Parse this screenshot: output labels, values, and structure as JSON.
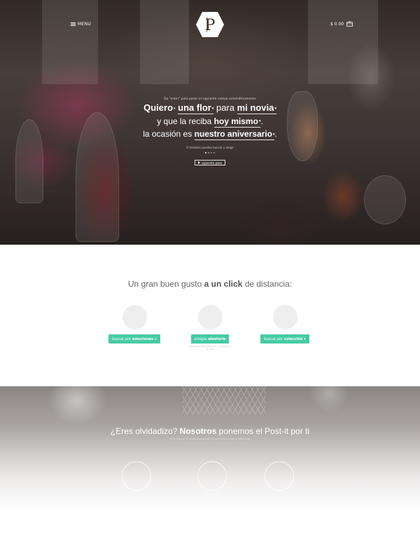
{
  "header": {
    "menu_label": "MENU",
    "logo_letter": "P",
    "cart_total": "$ 0.00"
  },
  "hero": {
    "hint": "Da \"enter\" para pasar al siguiente campo automáticamente",
    "line1": {
      "w1": "Quiero",
      "w2": "una flor",
      "w3": "para",
      "w4": "mi novia"
    },
    "line2": {
      "w1": "y que la reciba",
      "w2": "hoy mismo",
      "w3": "."
    },
    "line3": {
      "w1": "la ocasión es",
      "w2": "nuestro aniversario",
      "w3": "."
    },
    "sub": "O también puedes buscar y elegir",
    "next_button": "siguiente paso",
    "active_dot": 0,
    "dot_count": 4
  },
  "section2": {
    "title_pre": "Un gran buen gusto",
    "title_bold": "a un click",
    "title_post": "de distancia:",
    "options": [
      {
        "pre": "buscar por",
        "bold": "emociones",
        "caret": true,
        "note": ""
      },
      {
        "pre": "arreglo",
        "bold": "aleatorio",
        "caret": false,
        "note": "Déjanos sorprenderte con un arreglo de la casa"
      },
      {
        "pre": "buscar por",
        "bold": "colección",
        "caret": true,
        "note": ""
      }
    ]
  },
  "section3": {
    "title_pre": "¿Eres olvidadizo?",
    "title_bold": "Nosotros",
    "title_post": "ponemos el Post-it por ti",
    "sub": "Te recordamos las fechas importantes y te ayudamos a elegir el detalle ideal"
  },
  "colors": {
    "accent": "#47cba5",
    "circle": "#eeeeee"
  },
  "icons": [
    "hamburger-icon",
    "logo-hexagon-icon",
    "cart-icon",
    "caret-down-icon",
    "play-icon"
  ]
}
